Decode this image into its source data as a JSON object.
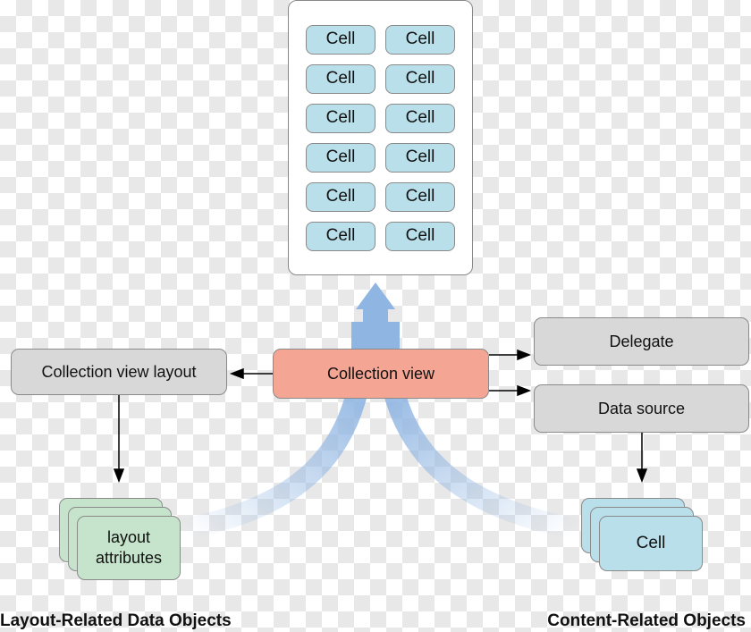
{
  "diagram": {
    "collection_view_cells": [
      "Cell",
      "Cell",
      "Cell",
      "Cell",
      "Cell",
      "Cell",
      "Cell",
      "Cell",
      "Cell",
      "Cell",
      "Cell",
      "Cell"
    ],
    "collection_view": "Collection view",
    "layout": "Collection view layout",
    "delegate": "Delegate",
    "data_source": "Data source",
    "layout_attributes_line1": "layout",
    "layout_attributes_line2": "attributes",
    "cell_object": "Cell",
    "left_caption": "Layout-Related Data Objects",
    "right_caption": "Content-Related Objects",
    "colors": {
      "collection_view": "#f4a593",
      "gray_box": "#d8d8d8",
      "cell": "#b9dfea",
      "layout_attributes": "#c5e4cb",
      "flow_arrow": "#8fb5e2"
    }
  }
}
